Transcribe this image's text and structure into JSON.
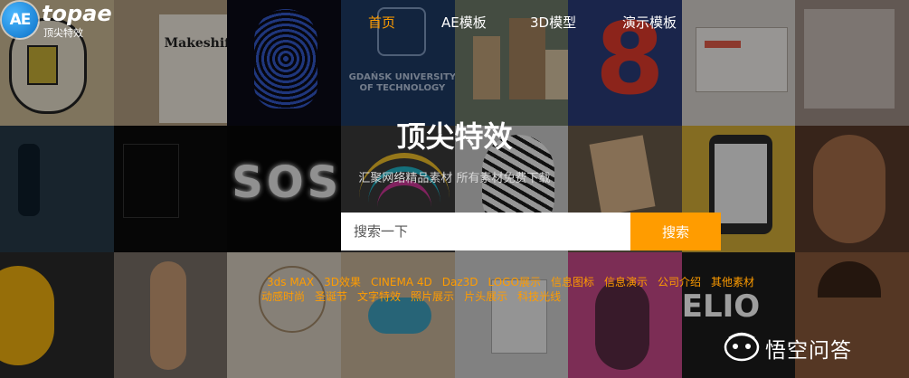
{
  "brand": {
    "mark": "AE",
    "name": "topae",
    "tagline": "顶尖特效"
  },
  "nav": {
    "items": [
      {
        "label": "首页",
        "active": true
      },
      {
        "label": "AE模板",
        "active": false
      },
      {
        "label": "3D模型",
        "active": false
      },
      {
        "label": "演示模板",
        "active": false
      }
    ]
  },
  "hero": {
    "title": "顶尖特效",
    "subtitle": "汇聚网络精品素材 所有素材免费下载"
  },
  "search": {
    "placeholder": "搜索一下",
    "button_label": "搜索"
  },
  "tags": [
    "3ds MAX",
    "3D效果",
    "CINEMA 4D",
    "Daz3D",
    "LOGO展示",
    "信息图标",
    "信息演示",
    "公司介绍",
    "其他素材",
    "动感时尚",
    "圣诞节",
    "文字特效",
    "照片展示",
    "片头展示",
    "科技光线"
  ],
  "background_tiles": {
    "makeshift_title": "Makeshift",
    "university_text": "GDAŃSK UNIVERSITY OF TECHNOLOGY",
    "sos_text": "SOS",
    "lio_text": "ELIO",
    "number_text": "8"
  },
  "watermark": {
    "text": "悟空问答"
  },
  "colors": {
    "accent": "#ff9c00",
    "logo_blue": "#0a6fc6"
  }
}
